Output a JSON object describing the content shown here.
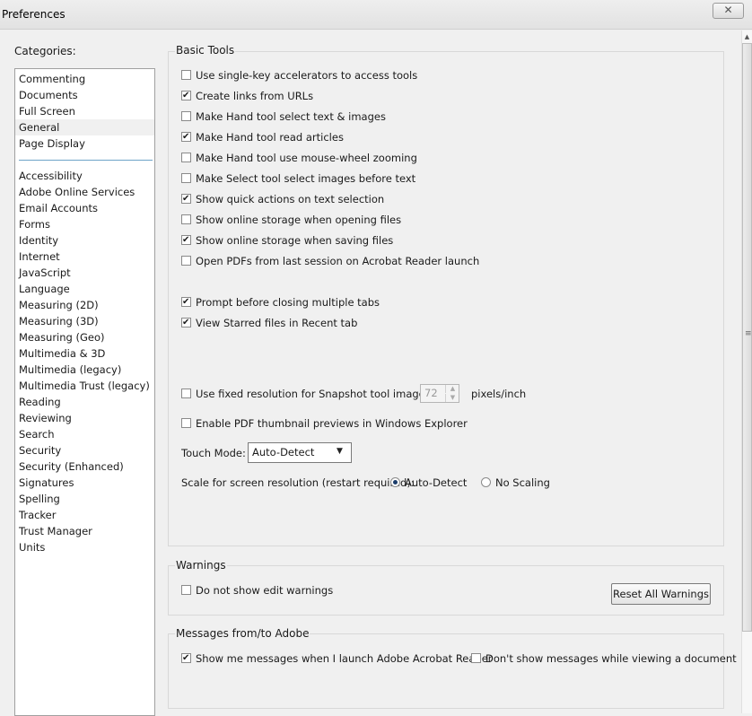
{
  "window": {
    "title": "Preferences",
    "close_glyph": "✕"
  },
  "categories": {
    "label": "Categories:",
    "primary": [
      "Commenting",
      "Documents",
      "Full Screen",
      "General",
      "Page Display"
    ],
    "selected": "General",
    "secondary": [
      "Accessibility",
      "Adobe Online Services",
      "Email Accounts",
      "Forms",
      "Identity",
      "Internet",
      "JavaScript",
      "Language",
      "Measuring (2D)",
      "Measuring (3D)",
      "Measuring (Geo)",
      "Multimedia & 3D",
      "Multimedia (legacy)",
      "Multimedia Trust (legacy)",
      "Reading",
      "Reviewing",
      "Search",
      "Security",
      "Security (Enhanced)",
      "Signatures",
      "Spelling",
      "Tracker",
      "Trust Manager",
      "Units"
    ]
  },
  "basic_tools": {
    "title": "Basic Tools",
    "options": [
      {
        "label": "Use single-key accelerators to access tools",
        "checked": false
      },
      {
        "label": "Create links from URLs",
        "checked": true
      },
      {
        "label": "Make Hand tool select text & images",
        "checked": false
      },
      {
        "label": "Make Hand tool read articles",
        "checked": true
      },
      {
        "label": "Make Hand tool use mouse-wheel zooming",
        "checked": false
      },
      {
        "label": "Make Select tool select images before text",
        "checked": false
      },
      {
        "label": "Show quick actions on text selection",
        "checked": true
      },
      {
        "label": "Show online storage when opening files",
        "checked": false
      },
      {
        "label": "Show online storage when saving files",
        "checked": true
      },
      {
        "label": "Open PDFs from last session on Acrobat Reader launch",
        "checked": false
      },
      {
        "label": "Prompt before closing multiple tabs",
        "checked": true
      },
      {
        "label": "View Starred files in Recent tab",
        "checked": true
      }
    ],
    "snapshot": {
      "label": "Use fixed resolution for Snapshot tool images:",
      "checked": false,
      "value": "72",
      "unit": "pixels/inch"
    },
    "thumbnail": {
      "label": "Enable PDF thumbnail previews in Windows Explorer",
      "checked": false
    },
    "touch_mode": {
      "label": "Touch Mode:",
      "value": "Auto-Detect"
    },
    "scale": {
      "label": "Scale for screen resolution (restart required):",
      "options": [
        "Auto-Detect",
        "No Scaling"
      ],
      "selected": "Auto-Detect"
    }
  },
  "warnings": {
    "title": "Warnings",
    "option": {
      "label": "Do not show edit warnings",
      "checked": false
    },
    "reset_label": "Reset All Warnings"
  },
  "messages": {
    "title": "Messages from/to Adobe",
    "options": [
      {
        "label": "Show me messages when I launch Adobe Acrobat Reader",
        "checked": true
      },
      {
        "label": "Don't show messages while viewing a document",
        "checked": false
      }
    ]
  }
}
